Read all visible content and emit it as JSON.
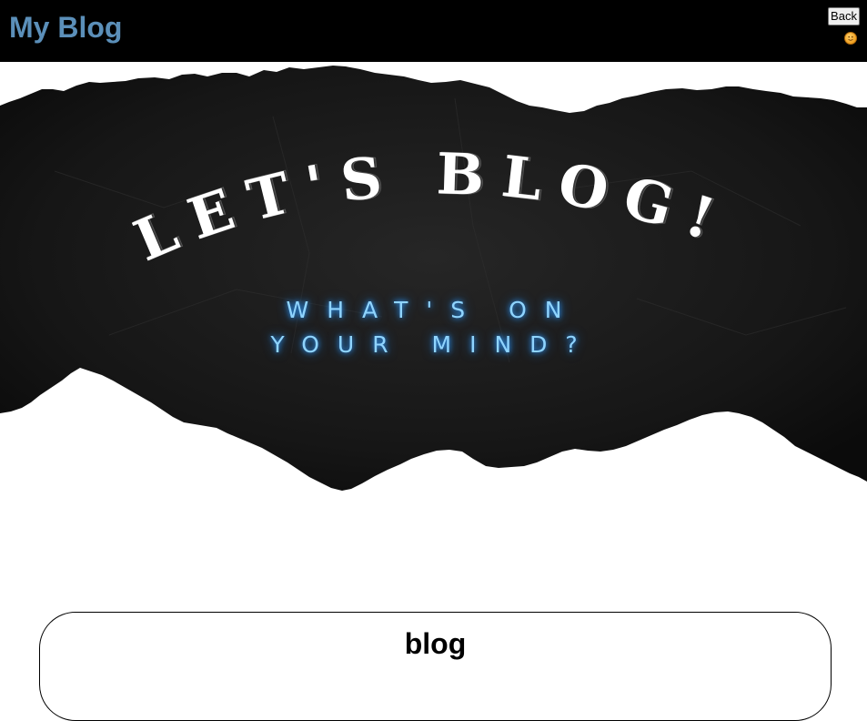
{
  "header": {
    "site_title": "My Blog",
    "back_label": "Back",
    "avatar_icon": "user-avatar-icon",
    "background_color": "#000000",
    "title_color": "#5b8fb9"
  },
  "hero": {
    "heading": "LET'S BLOG!",
    "tagline_line1": "WHAT'S ON",
    "tagline_line2": "YOUR MIND?",
    "tagline_color": "#8fd4ff"
  },
  "card": {
    "title": "blog"
  }
}
